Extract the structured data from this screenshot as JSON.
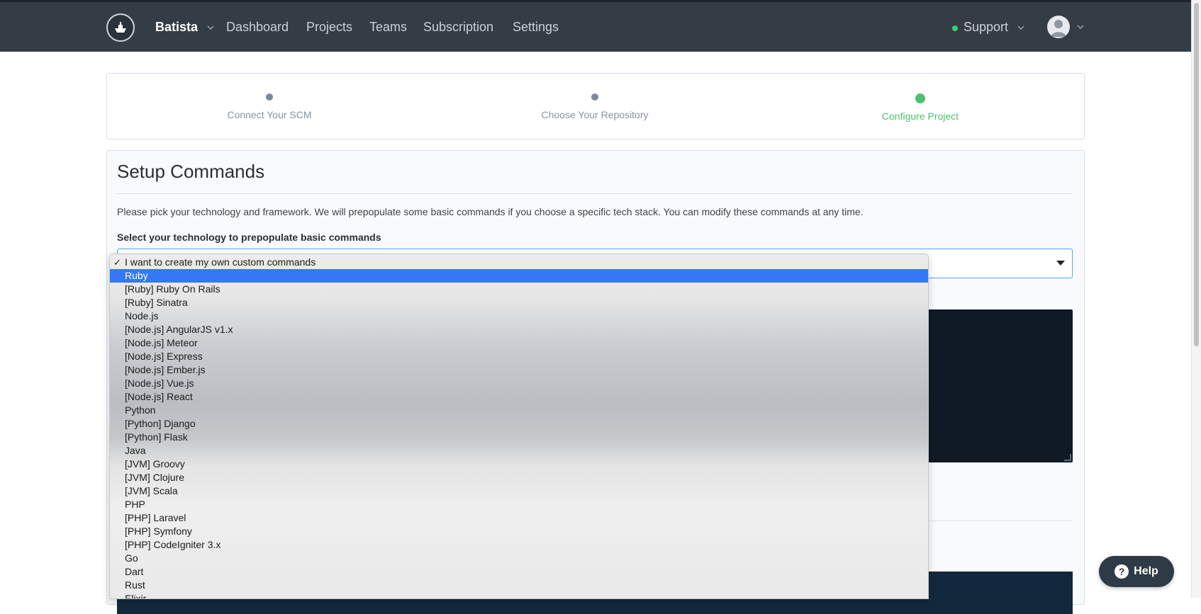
{
  "navbar": {
    "brand": "Batista",
    "links": [
      "Dashboard",
      "Projects",
      "Teams",
      "Subscription",
      "Settings"
    ],
    "support": "Support"
  },
  "steps": [
    {
      "label": "Connect Your SCM",
      "state": "done"
    },
    {
      "label": "Choose Your Repository",
      "state": "done"
    },
    {
      "label": "Configure Project",
      "state": "active"
    }
  ],
  "setup": {
    "title": "Setup Commands",
    "description": "Please pick your technology and framework. We will prepopulate some basic commands if you choose a specific tech stack. You can modify these commands at any time.",
    "select_label": "Select your technology to prepopulate basic commands",
    "selected_value": "I want to create my own custom commands"
  },
  "dropdown": {
    "checked": "I want to create my own custom commands",
    "highlighted": "Ruby",
    "options": [
      "I want to create my own custom commands",
      "Ruby",
      "[Ruby] Ruby On Rails",
      "[Ruby] Sinatra",
      "Node.js",
      "[Node.js] AngularJS v1.x",
      "[Node.js] Meteor",
      "[Node.js] Express",
      "[Node.js] Ember.js",
      "[Node.js] Vue.js",
      "[Node.js] React",
      "Python",
      "[Python] Django",
      "[Python] Flask",
      "Java",
      "[JVM] Groovy",
      "[JVM] Clojure",
      "[JVM] Scala",
      "PHP",
      "[PHP] Laravel",
      "[PHP] Symfony",
      "[PHP] CodeIgniter 3.x",
      "Go",
      "Dart",
      "Rust",
      "Elixir"
    ]
  },
  "help_button": "Help",
  "colors": {
    "navbar": "#343c46",
    "accent_green": "#4cc26f",
    "highlight_blue": "#3478f6",
    "editor_bg": "#0f1a26"
  }
}
